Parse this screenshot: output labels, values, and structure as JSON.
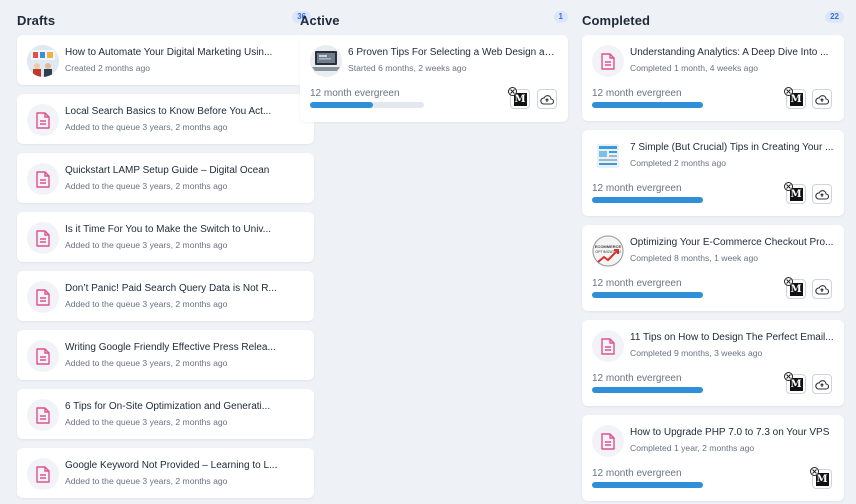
{
  "columns": {
    "drafts": {
      "title": "Drafts",
      "count": "36"
    },
    "active": {
      "title": "Active",
      "count": "1"
    },
    "completed": {
      "title": "Completed",
      "count": "22"
    }
  },
  "drafts": [
    {
      "title": "How to Automate Your Digital Marketing Usin...",
      "sub": "Created 2 months ago",
      "thumb": "marketing-image"
    },
    {
      "title": "Local Search Basics to Know Before You Act...",
      "sub": "Added to the queue 3 years, 2 months ago",
      "thumb": "document-icon"
    },
    {
      "title": "Quickstart LAMP Setup Guide – Digital Ocean",
      "sub": "Added to the queue 3 years, 2 months ago",
      "thumb": "document-icon"
    },
    {
      "title": "Is it Time For You to Make the Switch to Univ...",
      "sub": "Added to the queue 3 years, 2 months ago",
      "thumb": "document-icon"
    },
    {
      "title": "Don’t Panic! Paid Search Query Data is Not R...",
      "sub": "Added to the queue 3 years, 2 months ago",
      "thumb": "document-icon"
    },
    {
      "title": "Writing Google Friendly Effective Press Relea...",
      "sub": "Added to the queue 3 years, 2 months ago",
      "thumb": "document-icon"
    },
    {
      "title": "6 Tips for On-Site Optimization and Generati...",
      "sub": "Added to the queue 3 years, 2 months ago",
      "thumb": "document-icon"
    },
    {
      "title": "Google Keyword Not Provided – Learning to L...",
      "sub": "Added to the queue 3 years, 2 months ago",
      "thumb": "document-icon"
    }
  ],
  "active": [
    {
      "title": "6 Proven Tips For Selecting a Web Design an...",
      "sub": "Started 6 months, 2 weeks ago",
      "evergreen": "12 month evergreen",
      "progress": 0.55,
      "thumb": "laptop-image"
    }
  ],
  "completed": [
    {
      "title": "Understanding Analytics: A Deep Dive Into ...",
      "sub": "Completed 1 month, 4 weeks ago",
      "evergreen": "12 month evergreen",
      "progress": 1.0,
      "thumb": "document-icon"
    },
    {
      "title": "7 Simple (But Crucial) Tips in Creating Your ...",
      "sub": "Completed 2 months ago",
      "evergreen": "12 month evergreen",
      "progress": 1.0,
      "thumb": "webpage-image"
    },
    {
      "title": "Optimizing Your E-Commerce Checkout Pro...",
      "sub": "Completed 8 months, 1 week ago",
      "evergreen": "12 month evergreen",
      "progress": 1.0,
      "thumb": "ecommerce-badge-image",
      "thumb_text": "ECOMMERCE OPTIMIZATION"
    },
    {
      "title": "11 Tips on How to Design The Perfect Email...",
      "sub": "Completed 9 months, 3 weeks ago",
      "evergreen": "12 month evergreen",
      "progress": 1.0,
      "thumb": "document-icon"
    },
    {
      "title": "How to Upgrade PHP 7.0 to 7.3 on Your VPS",
      "sub": "Completed 1 year, 2 months ago",
      "evergreen": "12 month evergreen",
      "progress": 1.0,
      "thumb": "document-icon"
    }
  ],
  "icons": {
    "medium_letter": "M"
  },
  "colors": {
    "accent": "#2f8fd8",
    "doc_icon": "#e0528a",
    "badge_text": "#3b6fd8",
    "badge_bg": "#dce6fb"
  }
}
